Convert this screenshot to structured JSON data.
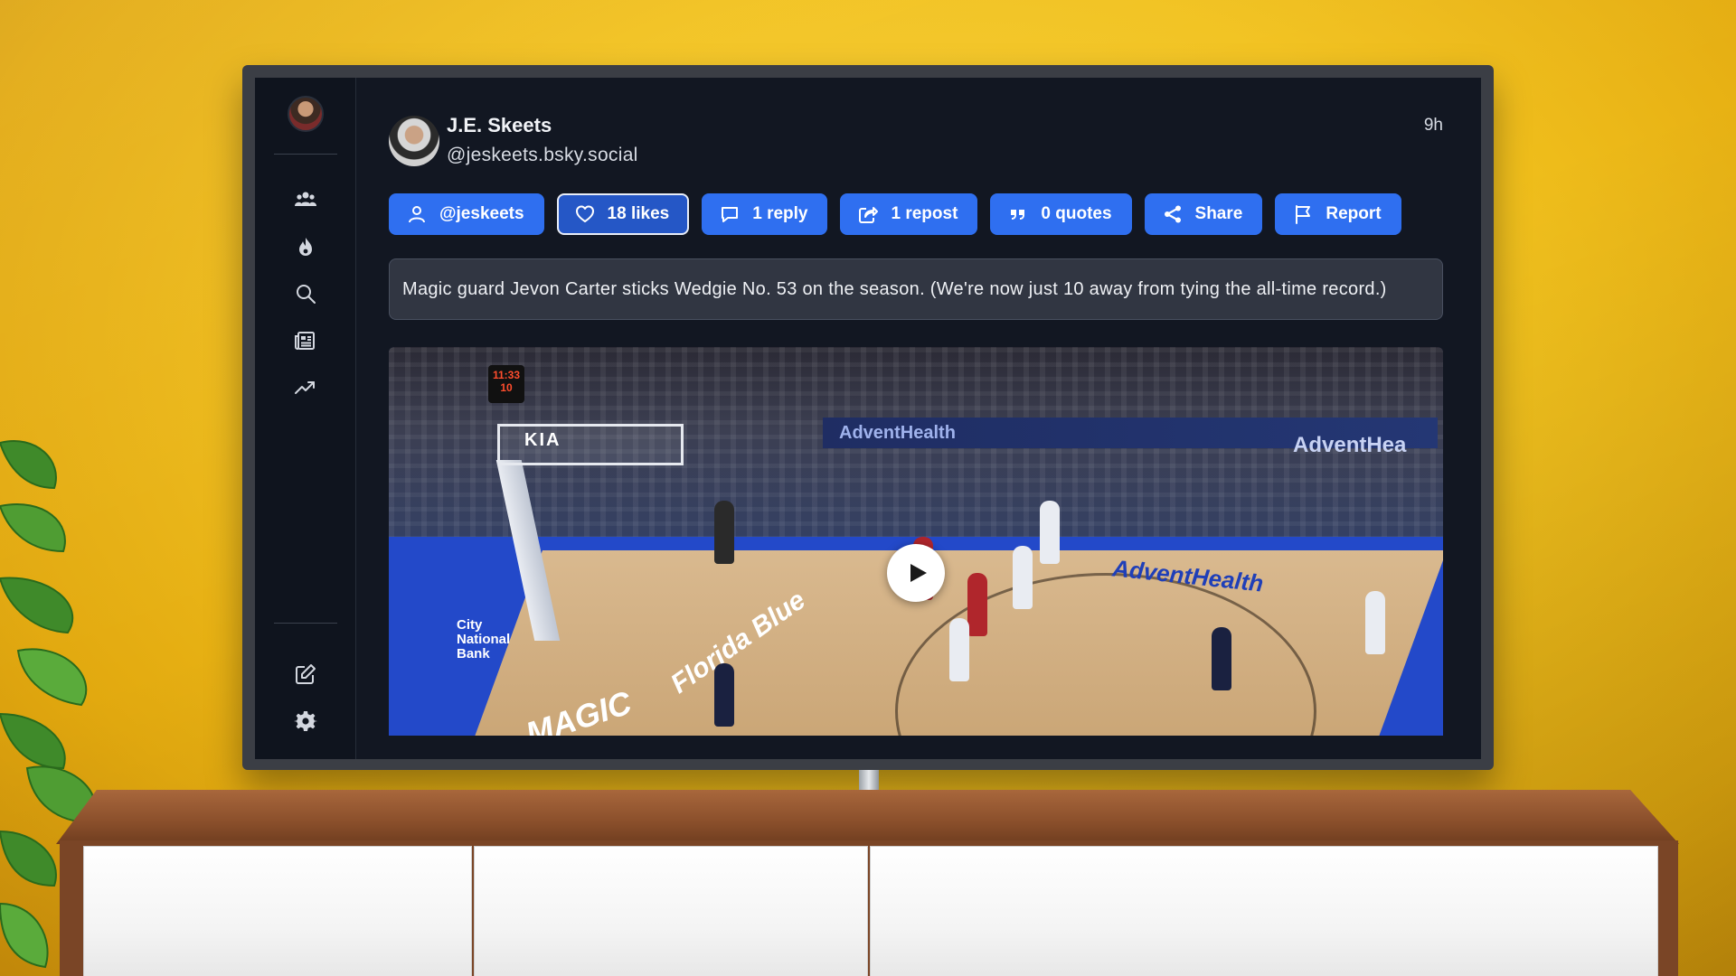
{
  "sidebar": {
    "nav_icons": [
      "users-icon",
      "flame-icon",
      "search-icon",
      "newspaper-icon",
      "trending-icon"
    ],
    "bottom_icons": [
      "compose-icon",
      "gear-icon"
    ]
  },
  "post": {
    "author_name": "J.E. Skeets",
    "author_handle": "@jeskeets.bsky.social",
    "time": "9h",
    "text": "Magic guard Jevon Carter sticks Wedgie No. 53 on the season. (We're now just 10 away from tying the all-time record.)"
  },
  "actions": {
    "profile_label": "@jeskeets",
    "likes_label": "18 likes",
    "reply_label": "1 reply",
    "repost_label": "1 repost",
    "quotes_label": "0 quotes",
    "share_label": "Share",
    "report_label": "Report"
  },
  "video": {
    "shot_clock_top": "11:33",
    "shot_clock_bottom": "10",
    "banner_text": "AdventHealth",
    "banner_right": "AdventHea",
    "hoop_brand": "KIA",
    "court_text_florida": "Florida Blue",
    "court_text_advent": "AdventHealth",
    "court_text_magic": "MAGIC",
    "court_text_bank": "City\nNational\nBank"
  },
  "colors": {
    "wall": "#f2c21e",
    "screen_bg": "#121722",
    "button": "#2f6ff0",
    "text_box": "#313642"
  }
}
